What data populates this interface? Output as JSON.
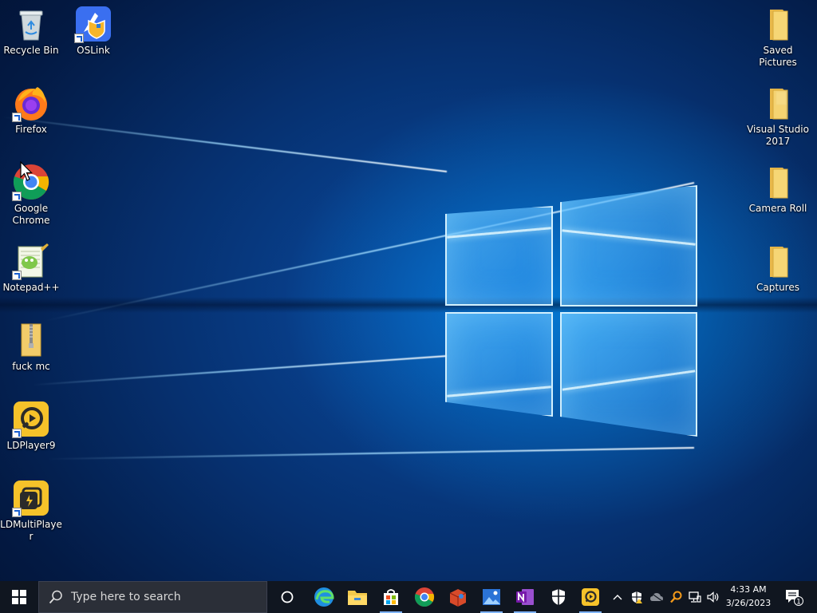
{
  "desktop": {
    "icons_left": [
      {
        "label": "Recycle Bin",
        "icon": "recycle-bin-icon",
        "shortcut": false
      },
      {
        "label": "OSLink",
        "icon": "oslink-icon",
        "shortcut": true
      },
      {
        "label": "Firefox",
        "icon": "firefox-icon",
        "shortcut": true
      },
      {
        "label": "Google Chrome",
        "icon": "chrome-icon",
        "shortcut": true
      },
      {
        "label": "Notepad++",
        "icon": "notepadpp-icon",
        "shortcut": true
      },
      {
        "label": "fuck mc",
        "icon": "zip-folder-icon",
        "shortcut": false
      },
      {
        "label": "LDPlayer9",
        "icon": "ldplayer-icon",
        "shortcut": true
      },
      {
        "label": "LDMultiPlayer",
        "icon": "ldmultiplayer-icon",
        "shortcut": true
      }
    ],
    "icons_right": [
      {
        "label": "Saved Pictures",
        "icon": "folder-icon"
      },
      {
        "label": "Visual Studio 2017",
        "icon": "folder-icon"
      },
      {
        "label": "Camera Roll",
        "icon": "folder-icon"
      },
      {
        "label": "Captures",
        "icon": "folder-icon"
      }
    ],
    "wallpaper_colors": {
      "deep": "#031a44",
      "mid": "#0a4fa8",
      "glow": "#5bc0ff"
    }
  },
  "taskbar": {
    "search_placeholder": "Type here to search",
    "pinned": [
      {
        "name": "cortana-icon"
      },
      {
        "name": "edge-icon"
      },
      {
        "name": "file-explorer-icon"
      },
      {
        "name": "microsoft-store-icon"
      },
      {
        "name": "chrome-icon"
      },
      {
        "name": "game-icon"
      },
      {
        "name": "photos-icon"
      },
      {
        "name": "onenote-icon"
      },
      {
        "name": "security-shield-icon"
      },
      {
        "name": "ldplayer-icon"
      }
    ],
    "tray": {
      "time": "4:33 AM",
      "date": "3/26/2023",
      "notification_count": "1"
    },
    "background": "#101620"
  }
}
